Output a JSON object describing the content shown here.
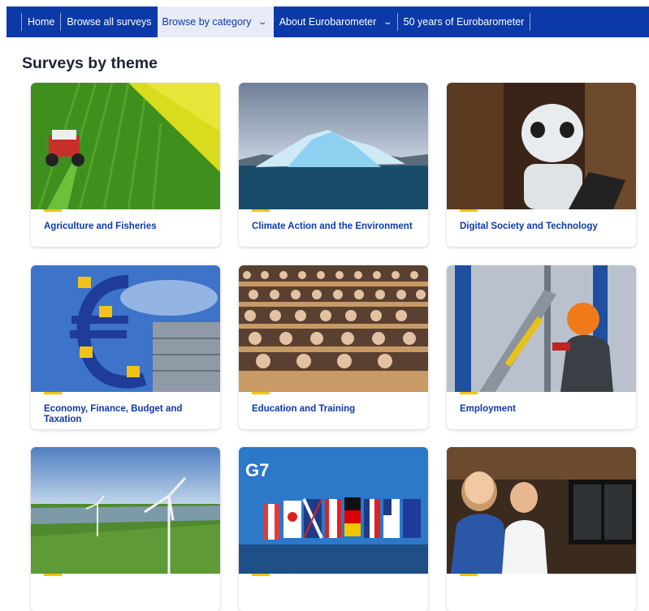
{
  "nav": {
    "items": [
      {
        "label": "Home"
      },
      {
        "label": "Browse all surveys"
      },
      {
        "label": "Browse by category",
        "chevron": "chevron-down-icon"
      },
      {
        "label": "About Eurobarometer",
        "chevron": "chevron-down-icon"
      },
      {
        "label": "50 years of Eurobarometer"
      }
    ]
  },
  "page": {
    "title": "Surveys by theme"
  },
  "cards": [
    {
      "label": "Agriculture and Fisheries",
      "image": "tractor-field-image"
    },
    {
      "label": "Climate Action and the Environment",
      "image": "iceberg-image"
    },
    {
      "label": "Digital Society and Technology",
      "image": "robot-image"
    },
    {
      "label": "Economy, Finance, Budget and Taxation",
      "image": "euro-sculpture-image"
    },
    {
      "label": "Education and Training",
      "image": "lecture-hall-image"
    },
    {
      "label": "Employment",
      "image": "industrial-worker-image"
    },
    {
      "label": "",
      "image": "wind-turbines-image"
    },
    {
      "label": "",
      "image": "g7-flags-image"
    },
    {
      "label": "",
      "image": "medical-scientists-image"
    }
  ],
  "colors": {
    "nav": "#0b3aa8",
    "active_tab": "#e7ecf8",
    "accent": "#f6c400",
    "link": "#0b3aa8"
  }
}
